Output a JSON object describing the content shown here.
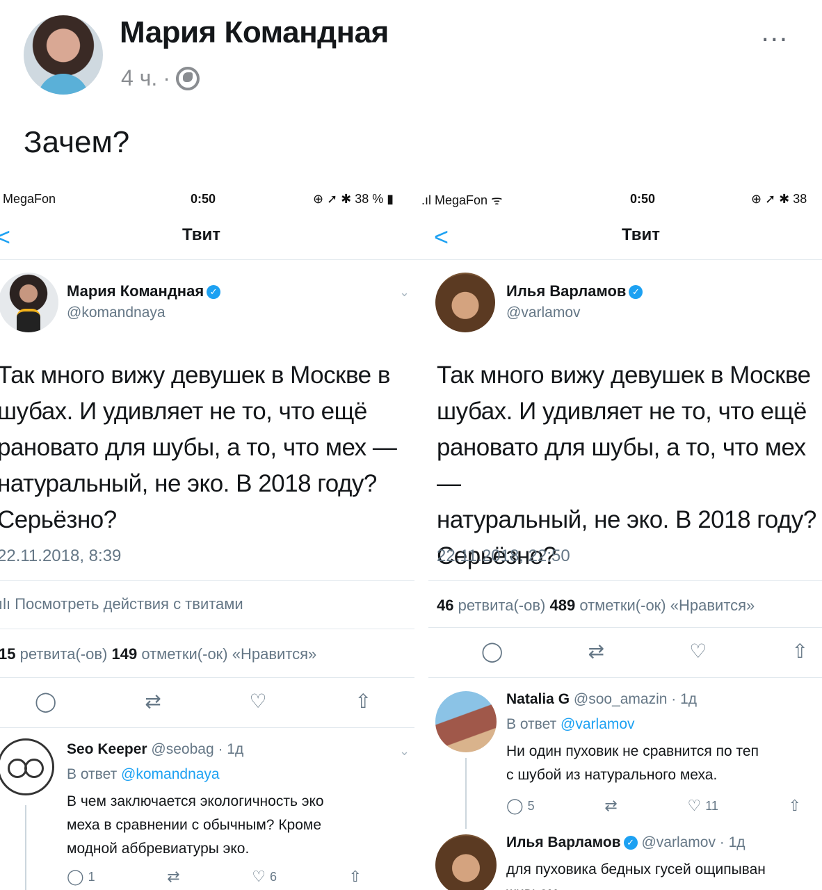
{
  "post": {
    "author": "Мария Командная",
    "time": "4 ч.",
    "separator": "·",
    "text": "Зачем?",
    "more": "..."
  },
  "left": {
    "status": {
      "carrier": "MegaFon",
      "time": "0:50",
      "battery": "38 %"
    },
    "nav": {
      "back": "<",
      "title": "Твит"
    },
    "tweet": {
      "name": "Мария Командная",
      "handle": "@komandnaya",
      "text": "Так много вижу девушек в Москве в\nшубах. И удивляет не то, что ещё\nрановато для шубы, а то, что мех —\nнатуральный, не эко. В 2018 году?\nСерьёзно?",
      "date": "22.11.2018, 8:39",
      "activity": "Посмотреть действия с твитами",
      "retweets": "15",
      "retweets_label": "ретвита(-ов)",
      "likes": "149",
      "likes_label": "отметки(-ок) «Нравится»"
    },
    "reply": {
      "name": "Seo Keeper",
      "handle_time": "@seobag · 1д",
      "reply_prefix": "В ответ",
      "reply_to": "@komandnaya",
      "text": "В чем заключается экологичность эко\nмеха в сравнении с обычным? Кроме\nмодной аббревиатуры эко.",
      "replies": "1",
      "likes": "6"
    }
  },
  "right": {
    "status": {
      "carrier": "MegaFon",
      "time": "0:50",
      "battery": "38"
    },
    "nav": {
      "back": "<",
      "title": "Твит"
    },
    "tweet": {
      "name": "Илья Варламов",
      "handle": "@varlamov",
      "text": "Так много вижу девушек в Москве\nшубах. И удивляет не то, что ещё\nрановато для шубы, а то, что мех —\nнатуральный, не эко. В 2018 году?\nСерьёзно?",
      "date": "22.11.2018, 22:50",
      "retweets": "46",
      "retweets_label": "ретвита(-ов)",
      "likes": "489",
      "likes_label": "отметки(-ок) «Нравится»"
    },
    "reply1": {
      "name": "Natalia G",
      "handle_time": "@soo_amazin · 1д",
      "reply_prefix": "В ответ",
      "reply_to": "@varlamov",
      "text": "Ни один пуховик не сравнится по теп\nс шубой из натурального меха.",
      "replies": "5",
      "likes": "11"
    },
    "reply2": {
      "name": "Илья Варламов",
      "handle_time": "@varlamov · 1д",
      "text": "для пуховика бедных гусей ощипыван\nживьем"
    }
  }
}
